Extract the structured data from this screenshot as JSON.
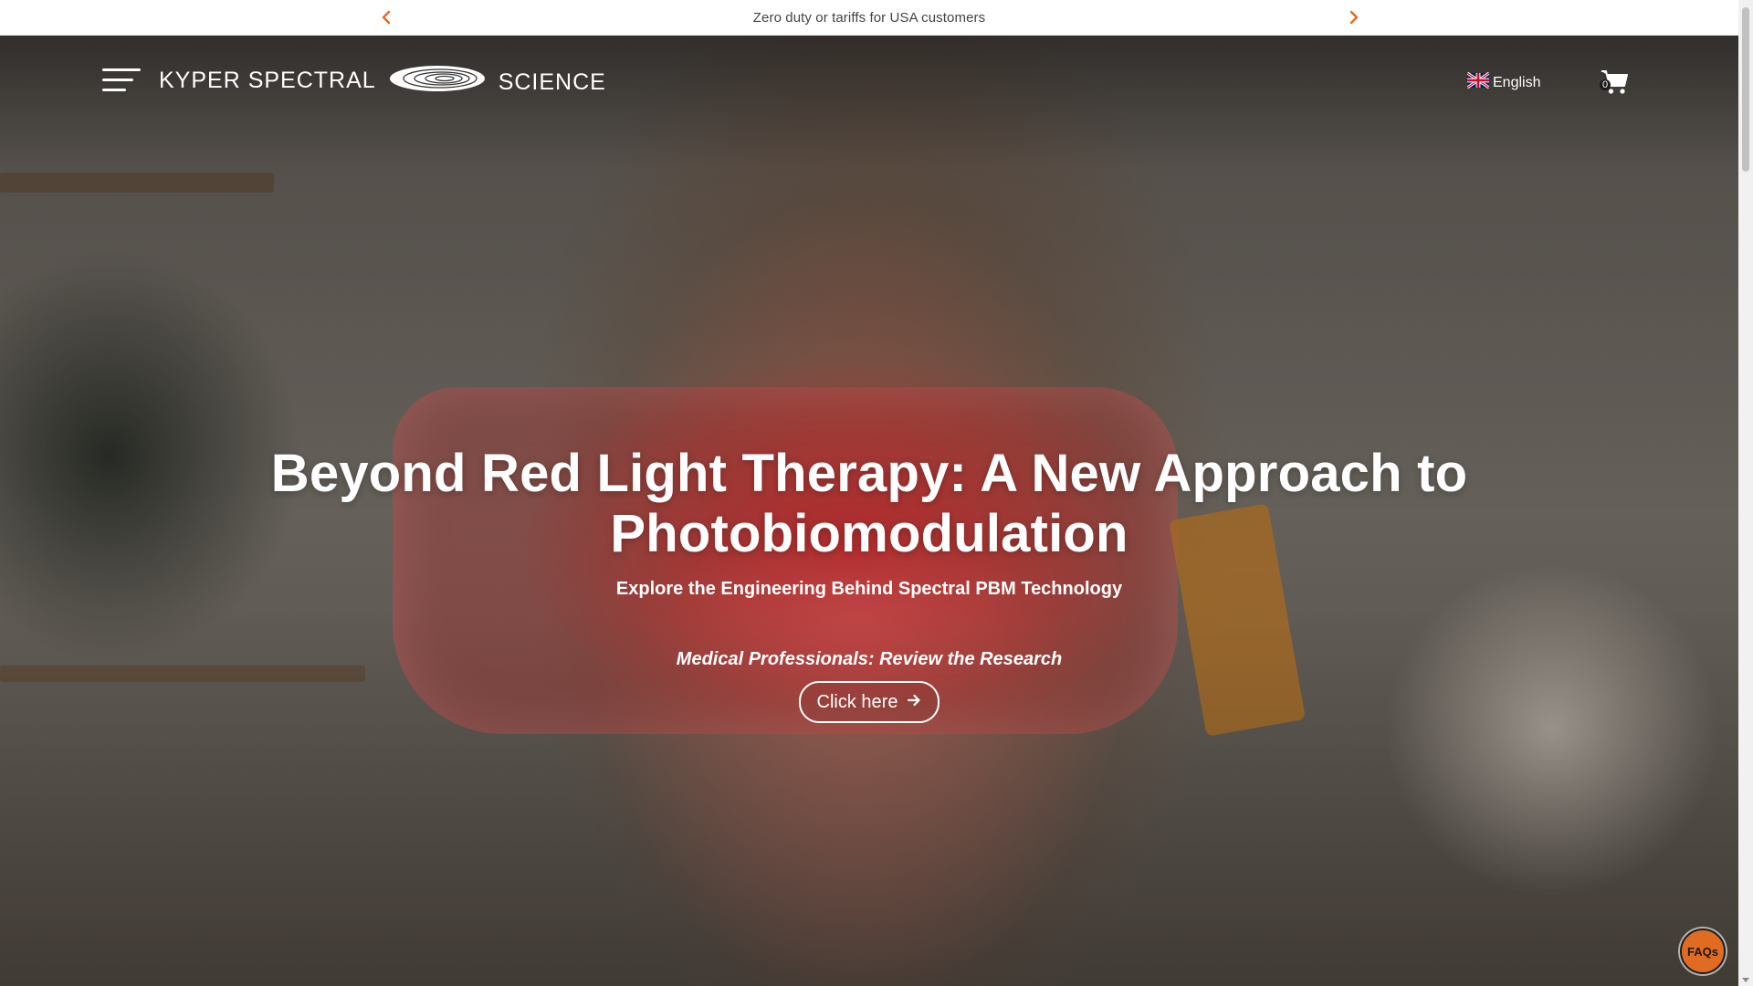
{
  "announcement": {
    "text": "Zero duty or tariffs for USA customers",
    "prev_icon": "chevron-left-icon",
    "next_icon": "chevron-right-icon",
    "arrow_color": "#e06b23"
  },
  "header": {
    "logo_left": "KYPER SPECTRAL",
    "logo_right": "SCIENCE",
    "menu_icon": "hamburger-menu-icon",
    "language": "English",
    "language_flag": "uk-flag-icon",
    "cart_icon": "shopping-cart-icon",
    "cart_count": "0"
  },
  "hero": {
    "title": "Beyond Red Light Therapy: A New Approach to Photobiomodulation",
    "subtitle": "Explore the Engineering Behind Spectral PBM Technology",
    "professionals_text": "Medical Professionals: Review the Research",
    "cta_label": "Click here",
    "cta_icon": "arrow-right-icon"
  },
  "faq": {
    "label": "FAQs",
    "color": "#e06b23"
  }
}
